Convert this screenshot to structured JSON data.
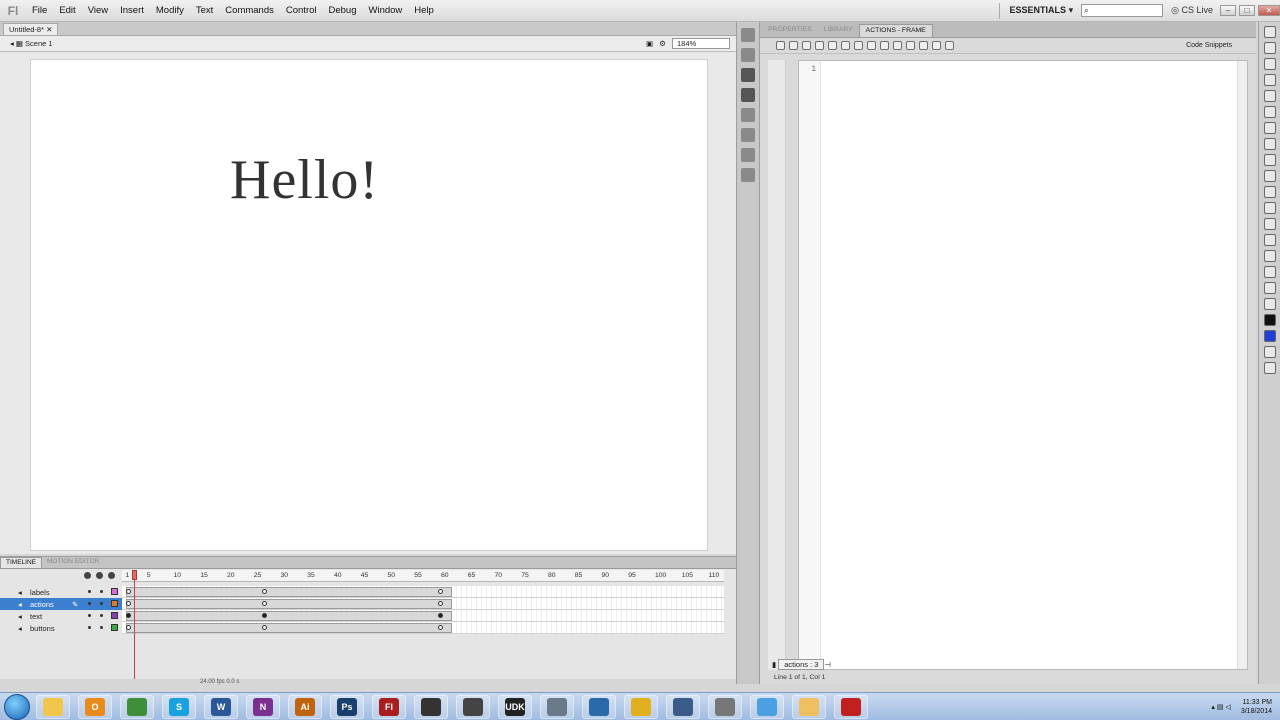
{
  "app": {
    "logo": "Fl"
  },
  "menu": [
    "File",
    "Edit",
    "View",
    "Insert",
    "Modify",
    "Text",
    "Commands",
    "Control",
    "Debug",
    "Window",
    "Help"
  ],
  "topright": {
    "workspace": "ESSENTIALS",
    "search_placeholder": "",
    "cslive": "CS Live"
  },
  "document": {
    "tab": "Untitled-8*",
    "scene": "Scene 1",
    "zoom": "184%"
  },
  "stage": {
    "text": "Hello!"
  },
  "panel": {
    "tabs": [
      "PROPERTIES",
      "LIBRARY",
      "ACTIONS - FRAME"
    ],
    "code_snippets": "Code Snippets",
    "line_number": "1",
    "script_tab": "actions : 3",
    "status": "Line 1 of 1, Col 1"
  },
  "timeline": {
    "tabs": [
      "TIMELINE",
      "MOTION EDITOR"
    ],
    "ruler": [
      "1",
      "5",
      "10",
      "15",
      "20",
      "25",
      "30",
      "35",
      "40",
      "45",
      "50",
      "55",
      "60",
      "65",
      "70",
      "75",
      "80",
      "85",
      "90",
      "95",
      "100",
      "105",
      "110"
    ],
    "layers": [
      {
        "name": "labels",
        "color": "#d86bd8"
      },
      {
        "name": "actions",
        "color": "#e07a2b",
        "selected": true
      },
      {
        "name": "text",
        "color": "#8a3db8"
      },
      {
        "name": "buttons",
        "color": "#3aa83a"
      }
    ],
    "footer": "24.00 fps   0.0 s"
  },
  "taskbar": {
    "apps": [
      {
        "name": "explorer",
        "label": "",
        "color": "#f2c64a"
      },
      {
        "name": "outlook",
        "label": "O",
        "color": "#e98a1c"
      },
      {
        "name": "chrome",
        "label": "",
        "color": "#3f8e3a"
      },
      {
        "name": "skype",
        "label": "S",
        "color": "#1aa1e0"
      },
      {
        "name": "word",
        "label": "W",
        "color": "#2b5797"
      },
      {
        "name": "onenote",
        "label": "N",
        "color": "#7b2f8f"
      },
      {
        "name": "illustrator",
        "label": "Ai",
        "color": "#c0640e"
      },
      {
        "name": "photoshop",
        "label": "Ps",
        "color": "#1a3e6e"
      },
      {
        "name": "flash",
        "label": "Fl",
        "color": "#a81d1d"
      },
      {
        "name": "app-10",
        "label": "",
        "color": "#333333"
      },
      {
        "name": "app-11",
        "label": "",
        "color": "#444444"
      },
      {
        "name": "app-12",
        "label": "UDK",
        "color": "#222222"
      },
      {
        "name": "app-13",
        "label": "",
        "color": "#6a7a8a"
      },
      {
        "name": "app-14",
        "label": "",
        "color": "#2a6aa8"
      },
      {
        "name": "app-15",
        "label": "",
        "color": "#e0b020"
      },
      {
        "name": "app-16",
        "label": "",
        "color": "#3b5b8b"
      },
      {
        "name": "app-17",
        "label": "",
        "color": "#777777"
      },
      {
        "name": "app-18",
        "label": "",
        "color": "#4aa0e0"
      },
      {
        "name": "app-19",
        "label": "",
        "color": "#f0c060"
      },
      {
        "name": "acrobat",
        "label": "",
        "color": "#c02020"
      }
    ],
    "time": "11:33 PM",
    "date": "3/18/2014"
  }
}
